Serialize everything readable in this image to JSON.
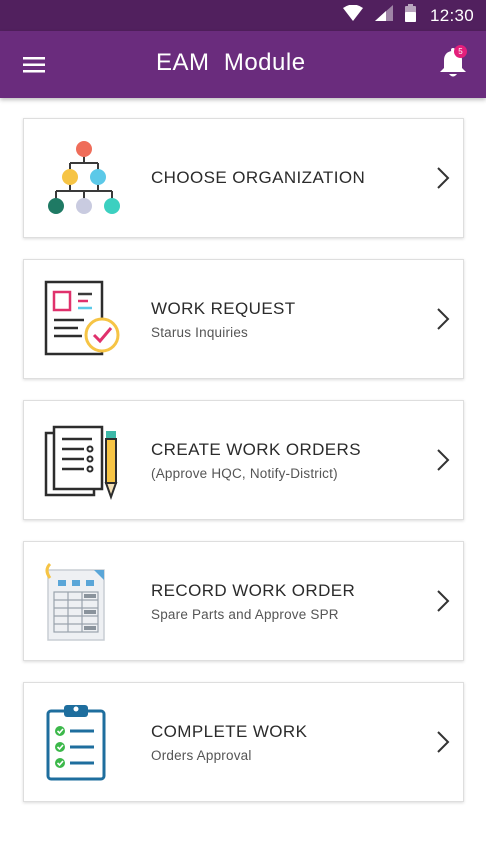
{
  "status_bar": {
    "time": "12:30"
  },
  "app_bar": {
    "title": "EAM  Module",
    "notification_count": "5"
  },
  "menu": [
    {
      "title": "CHOOSE ORGANIZATION",
      "subtitle": "",
      "icon": "org-chart-icon"
    },
    {
      "title": "WORK REQUEST",
      "subtitle": "Starus Inquiries",
      "icon": "request-form-icon"
    },
    {
      "title": "CREATE WORK ORDERS",
      "subtitle": "(Approve HQC, Notify-District)",
      "icon": "document-pen-icon"
    },
    {
      "title": "RECORD WORK ORDER",
      "subtitle": "Spare Parts and Approve SPR",
      "icon": "spreadsheet-icon"
    },
    {
      "title": "COMPLETE WORK",
      "subtitle": "Orders Approval",
      "icon": "clipboard-checklist-icon"
    }
  ],
  "colors": {
    "status_bar": "#51205e",
    "app_bar": "#6a2c7d",
    "badge": "#e41f7b"
  }
}
